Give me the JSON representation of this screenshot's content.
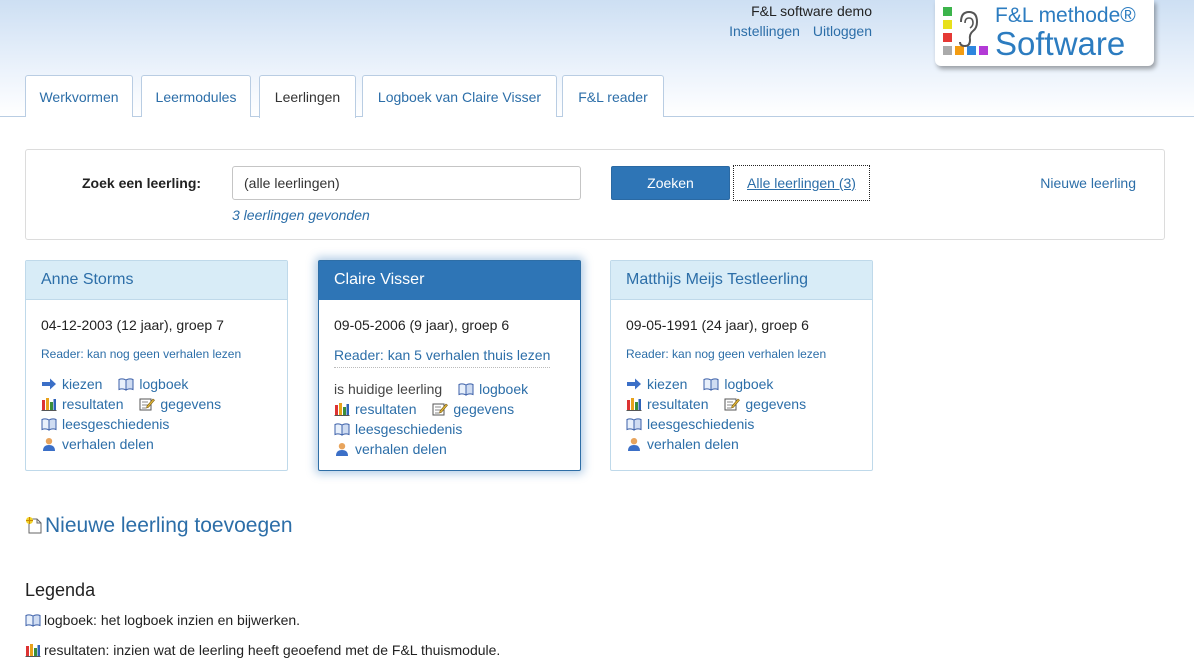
{
  "header": {
    "site_title": "F&L software demo",
    "links": [
      "Instellingen",
      "Uitloggen"
    ],
    "logo": {
      "line1": "F&L methode®",
      "line2": "Software"
    }
  },
  "tabs": [
    {
      "label": "Werkvormen",
      "active": false
    },
    {
      "label": "Leermodules",
      "active": false
    },
    {
      "label": "Leerlingen",
      "active": true
    },
    {
      "label": "Logboek van Claire Visser",
      "active": false
    },
    {
      "label": "F&L reader",
      "active": false
    }
  ],
  "search": {
    "label": "Zoek een leerling:",
    "value": "(alle leerlingen)",
    "found": "3 leerlingen gevonden",
    "search_button": "Zoeken",
    "all_button": "Alle leerlingen (3)",
    "new_link": "Nieuwe leerling"
  },
  "students": [
    {
      "name": "Anne Storms",
      "dob": "04-12-2003 (12 jaar), groep 7",
      "reader": "Reader: kan nog geen verhalen lezen",
      "active": false,
      "first_action": "kiezen",
      "actions": {
        "logbook": "logboek",
        "results": "resultaten",
        "data": "gegevens",
        "history": "leesgeschiedenis",
        "share": "verhalen delen"
      }
    },
    {
      "name": "Claire Visser",
      "dob": "09-05-2006 (9 jaar), groep 6",
      "reader": "Reader: kan 5 verhalen thuis lezen",
      "active": true,
      "first_action": "is huidige leerling",
      "actions": {
        "logbook": "logboek",
        "results": "resultaten",
        "data": "gegevens",
        "history": "leesgeschiedenis",
        "share": "verhalen delen"
      }
    },
    {
      "name": "Matthijs Meijs Testleerling",
      "dob": "09-05-1991 (24 jaar), groep 6",
      "reader": "Reader: kan nog geen verhalen lezen",
      "active": false,
      "first_action": "kiezen",
      "actions": {
        "logbook": "logboek",
        "results": "resultaten",
        "data": "gegevens",
        "history": "leesgeschiedenis",
        "share": "verhalen delen"
      }
    }
  ],
  "add_student": "Nieuwe leerling toevoegen",
  "legend": {
    "title": "Legenda",
    "items": [
      {
        "term": "logboek",
        "text": ": het logboek inzien en bijwerken."
      },
      {
        "term": "resultaten",
        "text": ": inzien wat de leerling heeft geoefend met de F&L thuismodule."
      }
    ]
  },
  "colors": {
    "accent": "#2e75b6",
    "link": "#2c6ea8",
    "card_header": "#d8ecf7",
    "card_border": "#bfd9ea"
  }
}
